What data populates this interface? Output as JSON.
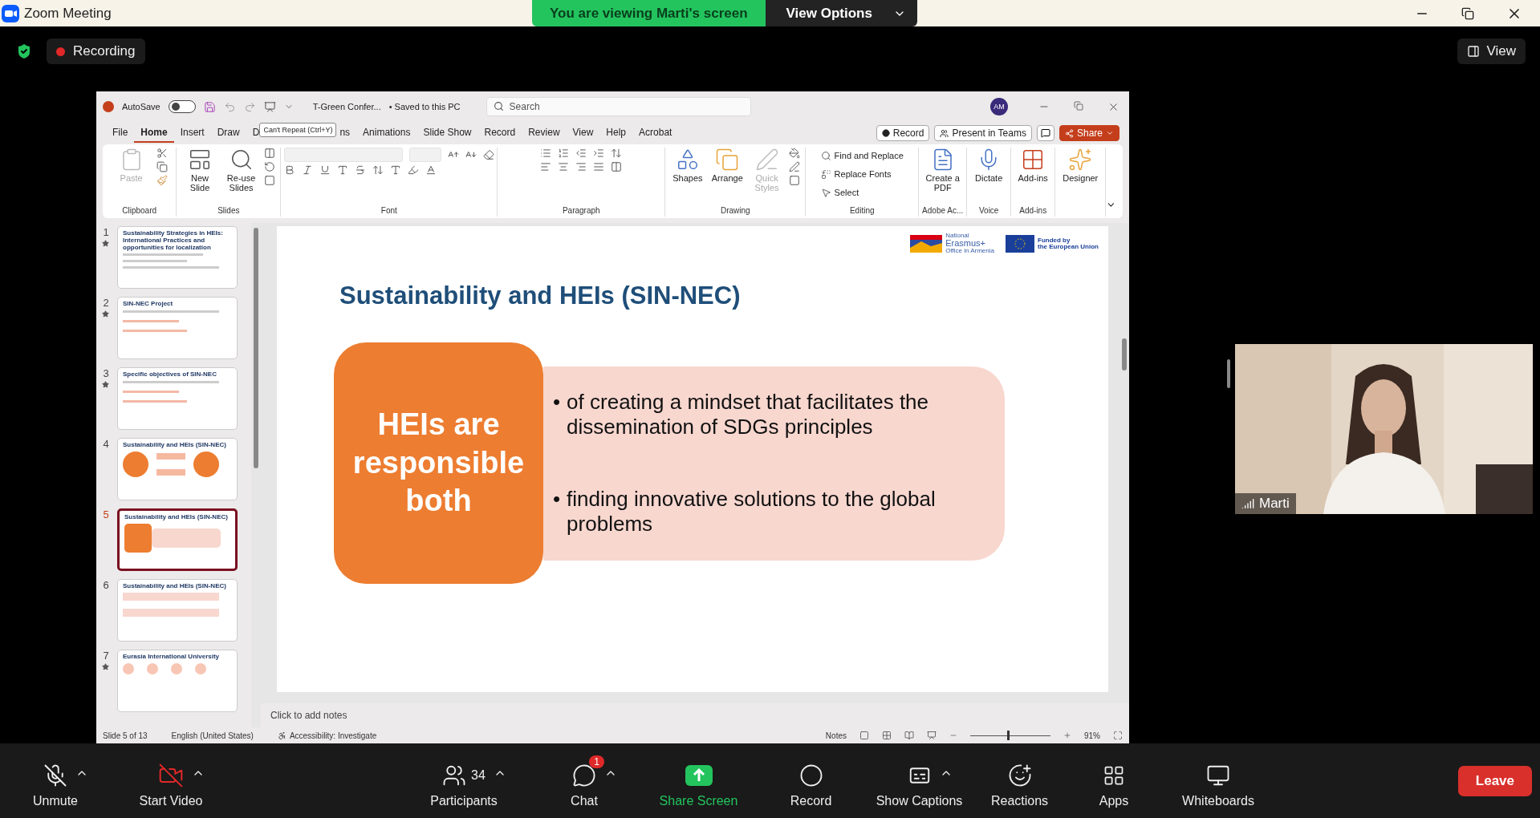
{
  "zoom_window": {
    "title": "Zoom Meeting"
  },
  "share_banner": {
    "text": "You are viewing Marti's screen",
    "options": "View Options"
  },
  "meeting_bar": {
    "recording": "Recording",
    "view": "View"
  },
  "powerpoint": {
    "titlebar": {
      "autosave": "AutoSave",
      "autosave_on": false,
      "file_name": "T-Green Confer...",
      "save_status": "• Saved to this PC",
      "search_placeholder": "Search",
      "avatar": "AM"
    },
    "tooltip": "Can't Repeat (Ctrl+Y)",
    "menu_tabs": [
      {
        "label": "File",
        "selected": false
      },
      {
        "label": "Home",
        "selected": true
      },
      {
        "label": "Insert",
        "selected": false
      },
      {
        "label": "Draw",
        "selected": false
      },
      {
        "label": "D",
        "selected": false
      },
      {
        "label": "ns",
        "selected": false
      },
      {
        "label": "Animations",
        "selected": false
      },
      {
        "label": "Slide Show",
        "selected": false
      },
      {
        "label": "Record",
        "selected": false
      },
      {
        "label": "Review",
        "selected": false
      },
      {
        "label": "View",
        "selected": false
      },
      {
        "label": "Help",
        "selected": false
      },
      {
        "label": "Acrobat",
        "selected": false
      }
    ],
    "header_buttons": [
      {
        "label": "Record",
        "kind": "record"
      },
      {
        "label": "Present in Teams",
        "kind": "teams"
      },
      {
        "label": "Share",
        "kind": "share"
      }
    ],
    "ribbon_groups": [
      {
        "name": "Clipboard",
        "kind": "clipboard",
        "buttons": [
          {
            "label": "Paste",
            "disabled": true
          }
        ]
      },
      {
        "name": "Slides",
        "kind": "slides",
        "buttons": [
          {
            "label": "New Slide",
            "disabled": false
          },
          {
            "label": "Re-use Slides",
            "disabled": false
          }
        ]
      },
      {
        "name": "Font",
        "kind": "font"
      },
      {
        "name": "Paragraph",
        "kind": "paragraph"
      },
      {
        "name": "Drawing",
        "kind": "drawing",
        "buttons": [
          {
            "label": "Shapes",
            "disabled": false
          },
          {
            "label": "Arrange",
            "disabled": false
          },
          {
            "label": "Quick Styles",
            "disabled": true
          }
        ]
      },
      {
        "name": "Editing",
        "kind": "editing",
        "buttons": [
          {
            "label": "Find and Replace",
            "disabled": false
          },
          {
            "label": "Replace Fonts",
            "disabled": false
          },
          {
            "label": "Select",
            "disabled": false
          }
        ]
      },
      {
        "name": "Adobe Ac...",
        "kind": "pdf",
        "buttons": [
          {
            "label": "Create a PDF",
            "disabled": false
          }
        ]
      },
      {
        "name": "Voice",
        "kind": "dictate",
        "buttons": [
          {
            "label": "Dictate",
            "disabled": false
          }
        ]
      },
      {
        "name": "Add-ins",
        "kind": "addins",
        "buttons": [
          {
            "label": "Add-ins",
            "disabled": false
          }
        ]
      },
      {
        "kind": "designer",
        "buttons": [
          {
            "label": "Designer",
            "disabled": false
          }
        ]
      }
    ],
    "thumbnails": [
      {
        "number": "1",
        "title": "Sustainability Strategies in HEIs: International Practices and opportunities for localization",
        "selected": false,
        "transition": true,
        "kind": "cover"
      },
      {
        "number": "2",
        "title": "SIN-NEC Project",
        "selected": false,
        "transition": true,
        "kind": "text"
      },
      {
        "number": "3",
        "title": "Specific objectives of SIN-NEC",
        "selected": false,
        "transition": true,
        "kind": "text"
      },
      {
        "number": "4",
        "title": "Sustainability and HEIs (SIN-NEC)",
        "selected": false,
        "transition": false,
        "kind": "circles"
      },
      {
        "number": "5",
        "title": "Sustainability and HEIs (SIN-NEC)",
        "selected": true,
        "transition": false,
        "kind": "boxes"
      },
      {
        "number": "6",
        "title": "Sustainability and HEIs (SIN-NEC)",
        "selected": false,
        "transition": false,
        "kind": "bars"
      },
      {
        "number": "7",
        "title": "Eurasia International University",
        "selected": false,
        "transition": true,
        "kind": "icons"
      }
    ],
    "slide": {
      "logos": [
        {
          "small": "National",
          "big": "Erasmus+",
          "sub": "Office in Armenia"
        },
        {
          "line1": "Funded by",
          "line2": "the European Union"
        }
      ],
      "title": "Sustainability and HEIs (SIN-NEC)",
      "box_text": "HEIs are responsible both",
      "bullet_mark": "•",
      "bullets": [
        "of creating a mindset that facilitates the dissemination of SDGs principles",
        "finding innovative solutions to the global problems"
      ]
    },
    "notes_placeholder": "Click to add notes",
    "status_bar": {
      "slide": "Slide 5 of 13",
      "language": "English (United States)",
      "accessibility": "Accessibility: Investigate",
      "notes": "Notes",
      "zoom": {
        "level": 0.46
      },
      "zoom_reading": "91%"
    }
  },
  "video": {
    "name": "Marti"
  },
  "toolbar": [
    {
      "label": "Unmute",
      "kind": "mic",
      "caret": true
    },
    {
      "label": "Start Video",
      "kind": "video",
      "caret": true
    },
    {
      "label": "Participants",
      "kind": "participants",
      "count": "34",
      "caret": true
    },
    {
      "label": "Chat",
      "kind": "chat",
      "badge": "1",
      "caret": true
    },
    {
      "label": "Share Screen",
      "kind": "share",
      "caret": false
    },
    {
      "label": "Record",
      "kind": "record",
      "caret": false
    },
    {
      "label": "Show Captions",
      "kind": "captions",
      "caret": true
    },
    {
      "label": "Reactions",
      "kind": "reactions",
      "caret": false
    },
    {
      "label": "Apps",
      "kind": "apps",
      "caret": false
    },
    {
      "label": "Whiteboards",
      "kind": "whiteboards",
      "caret": false
    }
  ],
  "leave": "Leave"
}
